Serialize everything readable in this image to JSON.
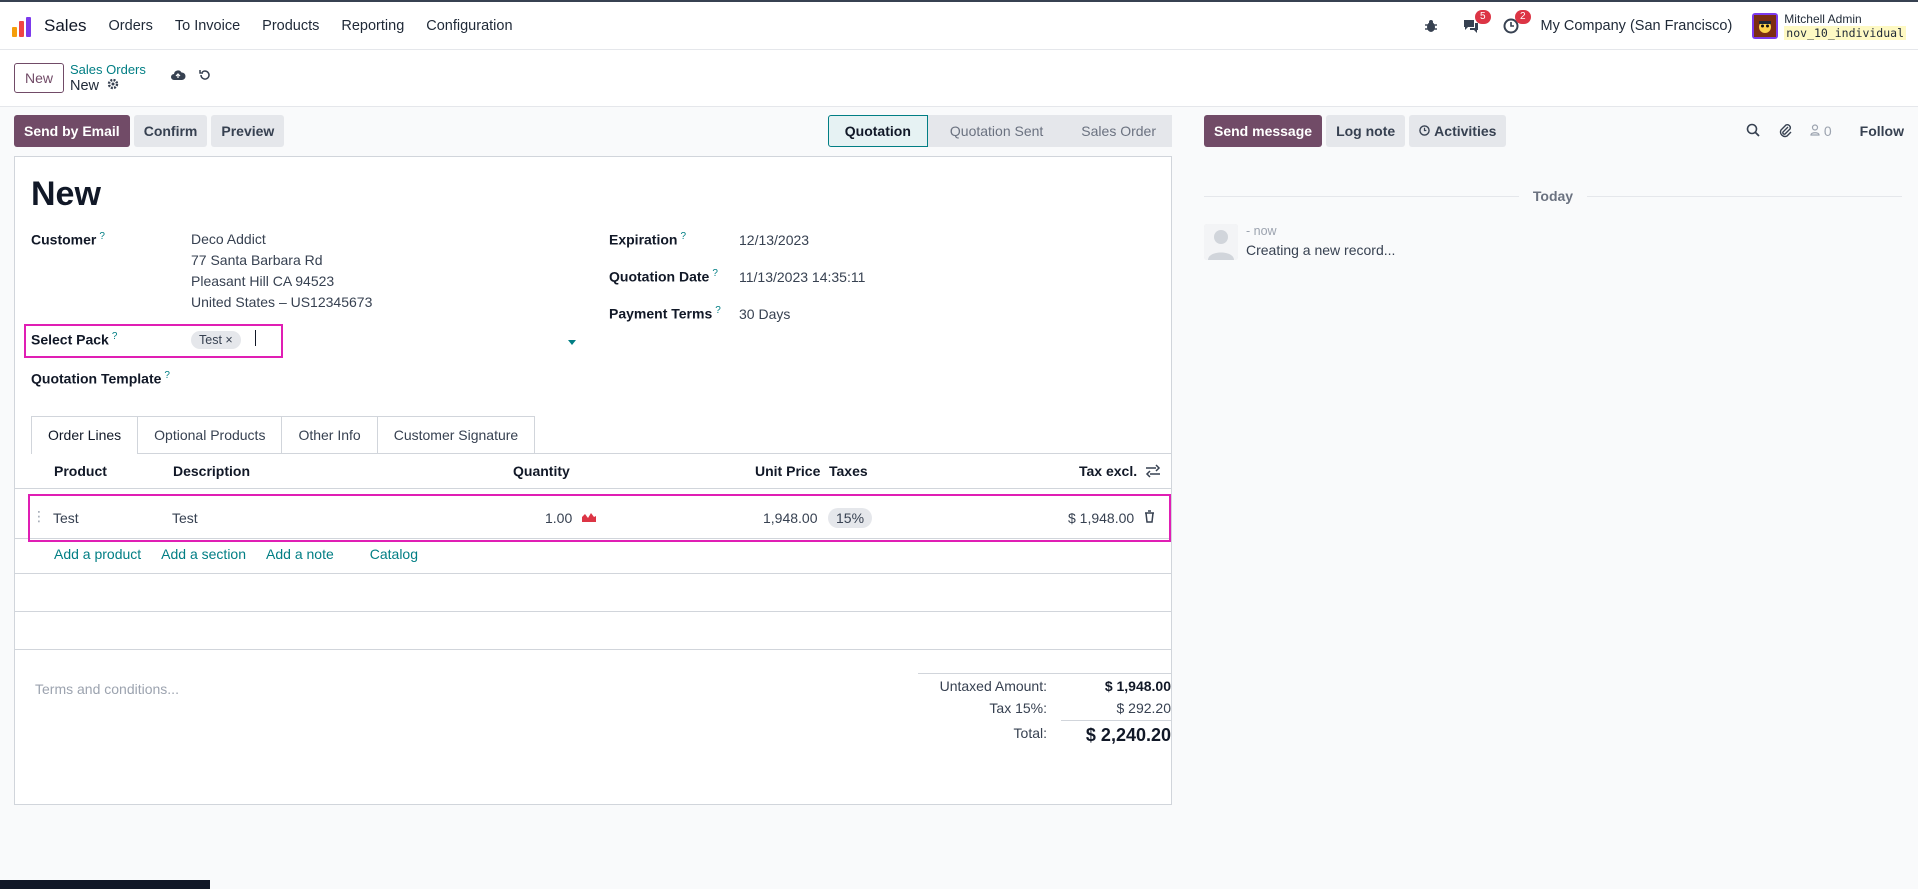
{
  "navbar": {
    "app_name": "Sales",
    "menu": [
      "Orders",
      "To Invoice",
      "Products",
      "Reporting",
      "Configuration"
    ],
    "chat_badge": "5",
    "activity_badge": "2",
    "company": "My Company (San Francisco)",
    "user_name": "Mitchell Admin",
    "db_name": "nov_10_individual"
  },
  "control": {
    "new_label": "New",
    "breadcrumb_parent": "Sales Orders",
    "breadcrumb_current": "New"
  },
  "actions": {
    "send_email": "Send by Email",
    "confirm": "Confirm",
    "preview": "Preview"
  },
  "status": {
    "stages": [
      "Quotation",
      "Quotation Sent",
      "Sales Order"
    ],
    "active": "Quotation"
  },
  "form": {
    "title": "New",
    "customer_label": "Customer",
    "customer_name": "Deco Addict",
    "customer_addr1": "77 Santa Barbara Rd",
    "customer_addr2": "Pleasant Hill CA 94523",
    "customer_addr3": "United States – US12345673",
    "select_pack_label": "Select Pack",
    "pack_tag": "Test",
    "template_label": "Quotation Template",
    "expiration_label": "Expiration",
    "expiration_value": "12/13/2023",
    "quotation_date_label": "Quotation Date",
    "quotation_date_value": "11/13/2023 14:35:11",
    "payment_terms_label": "Payment Terms",
    "payment_terms_value": "30 Days",
    "help_mark": "?"
  },
  "tabs": [
    "Order Lines",
    "Optional Products",
    "Other Info",
    "Customer Signature"
  ],
  "table": {
    "headers": {
      "product": "Product",
      "description": "Description",
      "quantity": "Quantity",
      "unit_price": "Unit Price",
      "taxes": "Taxes",
      "tax_excl": "Tax excl."
    },
    "rows": [
      {
        "product": "Test",
        "description": "Test",
        "quantity": "1.00",
        "unit_price": "1,948.00",
        "taxes": "15%",
        "subtotal": "$ 1,948.00"
      }
    ],
    "add_product": "Add a product",
    "add_section": "Add a section",
    "add_note": "Add a note",
    "catalog": "Catalog"
  },
  "terms_placeholder": "Terms and conditions...",
  "totals": {
    "untaxed_label": "Untaxed Amount:",
    "untaxed_value": "$ 1,948.00",
    "tax_label": "Tax 15%:",
    "tax_value": "$ 292.20",
    "total_label": "Total:",
    "total_value": "$ 2,240.20"
  },
  "chatter": {
    "send_message": "Send message",
    "log_note": "Log note",
    "activities": "Activities",
    "followers_count": "0",
    "follow": "Follow",
    "today": "Today",
    "msg_meta": "- now",
    "msg_body": "Creating a new record..."
  },
  "colors": {
    "primary": "#714b67",
    "accent": "#017e84",
    "highlight": "#e01eb4",
    "badge": "#dc3545"
  }
}
